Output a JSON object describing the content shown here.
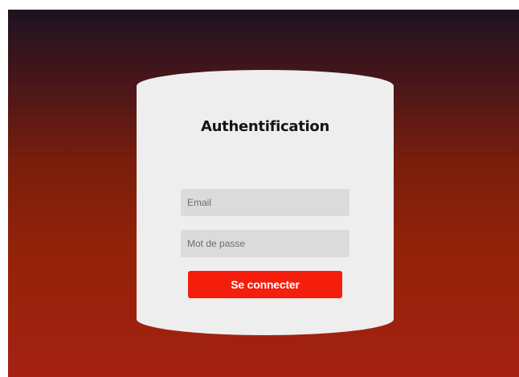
{
  "login_card": {
    "title": "Authentification",
    "email": {
      "value": "",
      "placeholder": "Email"
    },
    "password": {
      "value": "",
      "placeholder": "Mot de passe"
    },
    "submit_label": "Se connecter"
  },
  "colors": {
    "background_top": "#1e1221",
    "background_bottom": "#a52111",
    "card": "#eeeeee",
    "input": "#dcdbdb",
    "accent": "#f51e0c"
  }
}
